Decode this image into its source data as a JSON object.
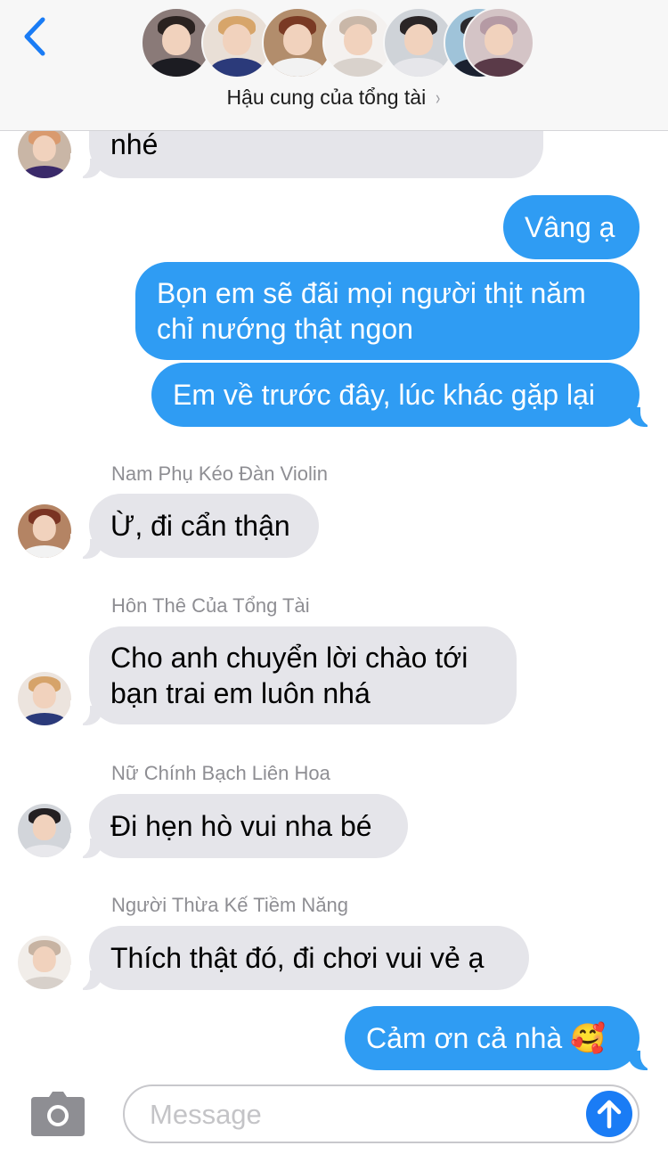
{
  "header": {
    "group_name": "Hậu cung của tổng tài",
    "group_chevron": "›",
    "back_icon": "chevron-left-icon",
    "accent_color": "#1a7cf5",
    "participant_count_shown": 7
  },
  "messages": [
    {
      "direction": "incoming",
      "sender": "",
      "text": "nhé"
    },
    {
      "direction": "outgoing",
      "text": "Vâng ạ"
    },
    {
      "direction": "outgoing",
      "text": "Bọn em sẽ đãi mọi người thịt năm\nchỉ nướng thật ngon"
    },
    {
      "direction": "outgoing",
      "text": "Em về trước đây, lúc khác gặp lại"
    },
    {
      "direction": "incoming",
      "sender": "Nam Phụ Kéo Đàn Violin",
      "text": "Ừ, đi cẩn thận"
    },
    {
      "direction": "incoming",
      "sender": "Hôn Thê Của Tổng Tài",
      "text": "Cho anh chuyển lời chào tới\nbạn trai em luôn nhá"
    },
    {
      "direction": "incoming",
      "sender": "Nữ Chính Bạch Liên Hoa",
      "text": "Đi hẹn hò vui nha bé"
    },
    {
      "direction": "incoming",
      "sender": "Người Thừa Kế Tiềm Năng",
      "text": "Thích thật đó, đi chơi vui vẻ ạ"
    },
    {
      "direction": "outgoing",
      "text": "Cảm ơn cả nhà 🥰"
    }
  ],
  "composer": {
    "placeholder": "Message",
    "value": "",
    "camera_icon": "camera-icon",
    "send_icon": "arrow-up-icon"
  },
  "colors": {
    "incoming_bubble": "#e5e5ea",
    "outgoing_bubble": "#2f9cf3",
    "sender_name": "#8e8e93"
  }
}
